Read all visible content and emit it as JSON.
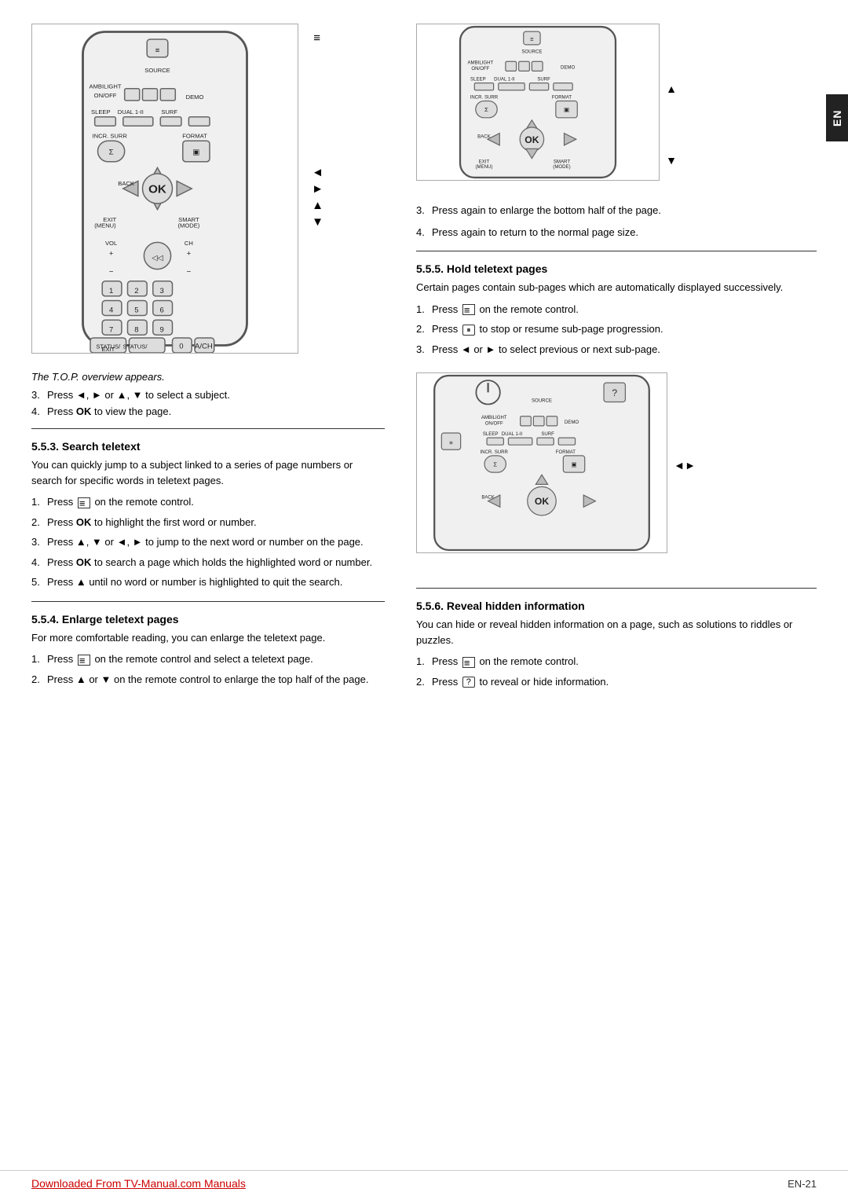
{
  "page": {
    "side_tab": "EN",
    "footer": {
      "link_text": "Downloaded From TV-Manual.com Manuals",
      "page_number": "EN-21"
    }
  },
  "left_col": {
    "remote_caption": "The T.O.P. overview appears.",
    "step3_label": "3.",
    "step3_text": "Press ◄, ► or ▲, ▼ to select a subject.",
    "step4_label": "4.",
    "step4_text": "Press OK to view the page.",
    "section_553": {
      "title": "5.5.3.  Search teletext",
      "intro": "You can quickly jump to a subject linked to a series of page numbers or search for specific words in teletext pages.",
      "steps": [
        {
          "num": "1.",
          "text": "Press  on the remote control."
        },
        {
          "num": "2.",
          "text": "Press OK to highlight the first word or number."
        },
        {
          "num": "3.",
          "text": "Press ▲, ▼ or ◄, ► to jump to the next word or number on the page."
        },
        {
          "num": "4.",
          "text": "Press OK to search a page which holds the highlighted word or number."
        },
        {
          "num": "5.",
          "text": "Press ▲ until no word or number is highlighted to quit the search."
        }
      ]
    },
    "section_554": {
      "title": "5.5.4.  Enlarge teletext pages",
      "intro": "For more comfortable reading, you can enlarge the teletext page.",
      "steps": [
        {
          "num": "1.",
          "text": "Press  on the remote control and select a teletext page."
        },
        {
          "num": "2.",
          "text": "Press ▲ or ▼ on the remote control to enlarge the top half of the page."
        }
      ]
    }
  },
  "right_col": {
    "step3_label": "3.",
    "step3_text": "Press again to enlarge the bottom half of the page.",
    "step4_label": "4.",
    "step4_text": "Press again to return to the normal page size.",
    "section_555": {
      "title": "5.5.5.  Hold teletext pages",
      "intro": "Certain pages contain sub-pages which are automatically displayed successively.",
      "steps": [
        {
          "num": "1.",
          "text": "Press  on the remote control."
        },
        {
          "num": "2.",
          "text": "Press  to stop or resume sub-page progression."
        },
        {
          "num": "3.",
          "text": "Press ◄ or ► to select previous or next sub-page."
        }
      ]
    },
    "section_556": {
      "title": "5.5.6.  Reveal hidden information",
      "intro": "You can hide or reveal hidden information on a page, such as solutions to riddles or puzzles.",
      "steps": [
        {
          "num": "1.",
          "text": "Press  on the remote control."
        },
        {
          "num": "2.",
          "text": "Press  to reveal or hide information."
        }
      ]
    }
  }
}
